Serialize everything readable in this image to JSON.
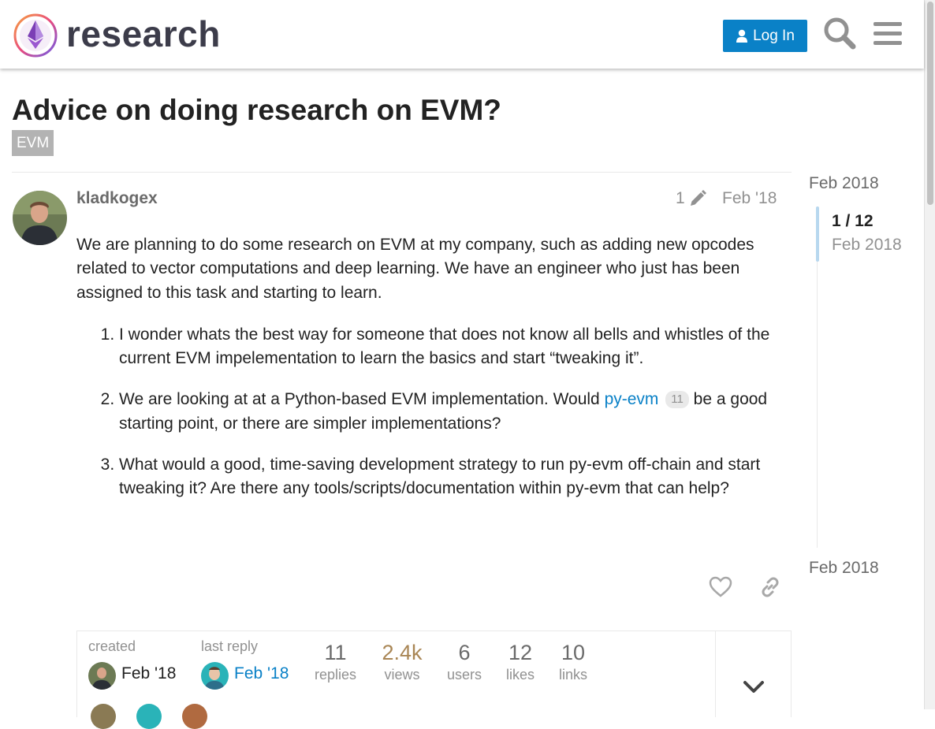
{
  "header": {
    "site_name": "research",
    "login_label": "Log In",
    "icons": [
      "logo-icon",
      "user-icon",
      "search-icon",
      "hamburger-menu-icon"
    ]
  },
  "topic": {
    "title": "Advice on doing research on EVM?",
    "tag": "EVM"
  },
  "post": {
    "username": "kladkogex",
    "edit_count": "1",
    "date": "Feb '18",
    "intro": "We are planning to do some research on EVM at my company, such as adding new opcodes related to vector computations and deep learning. We have an engineer who just has been assigned to this task and starting to learn.",
    "list": [
      {
        "text": "I wonder whats the best way for someone that does not know all bells and whistles of the current EVM impelementation to learn the basics and start “tweaking it”."
      },
      {
        "before": "We are looking at at a Python-based EVM implementation. Would ",
        "link": "py-evm",
        "link_clicks": "11",
        "after": " be a good starting point, or there are simpler implementations?"
      },
      {
        "text": "What would a good, time-saving development strategy to run py-evm off-chain and start tweaking it? Are there any tools/scripts/documentation within py-evm that can help?"
      }
    ]
  },
  "topic_map": {
    "created_label": "created",
    "created_date": "Feb '18",
    "last_reply_label": "last reply",
    "last_reply_date": "Feb '18",
    "stats": [
      {
        "num": "11",
        "label": "replies"
      },
      {
        "num": "2.4k",
        "label": "views"
      },
      {
        "num": "6",
        "label": "users"
      },
      {
        "num": "12",
        "label": "likes"
      },
      {
        "num": "10",
        "label": "links"
      }
    ]
  },
  "timeline": {
    "top_date": "Feb 2018",
    "index": "1 / 12",
    "current_date": "Feb 2018",
    "bottom_date": "Feb 2018"
  },
  "colors": {
    "accent": "#0a81c7",
    "tag_bg": "#b3b3b3",
    "views": "#a98655"
  }
}
